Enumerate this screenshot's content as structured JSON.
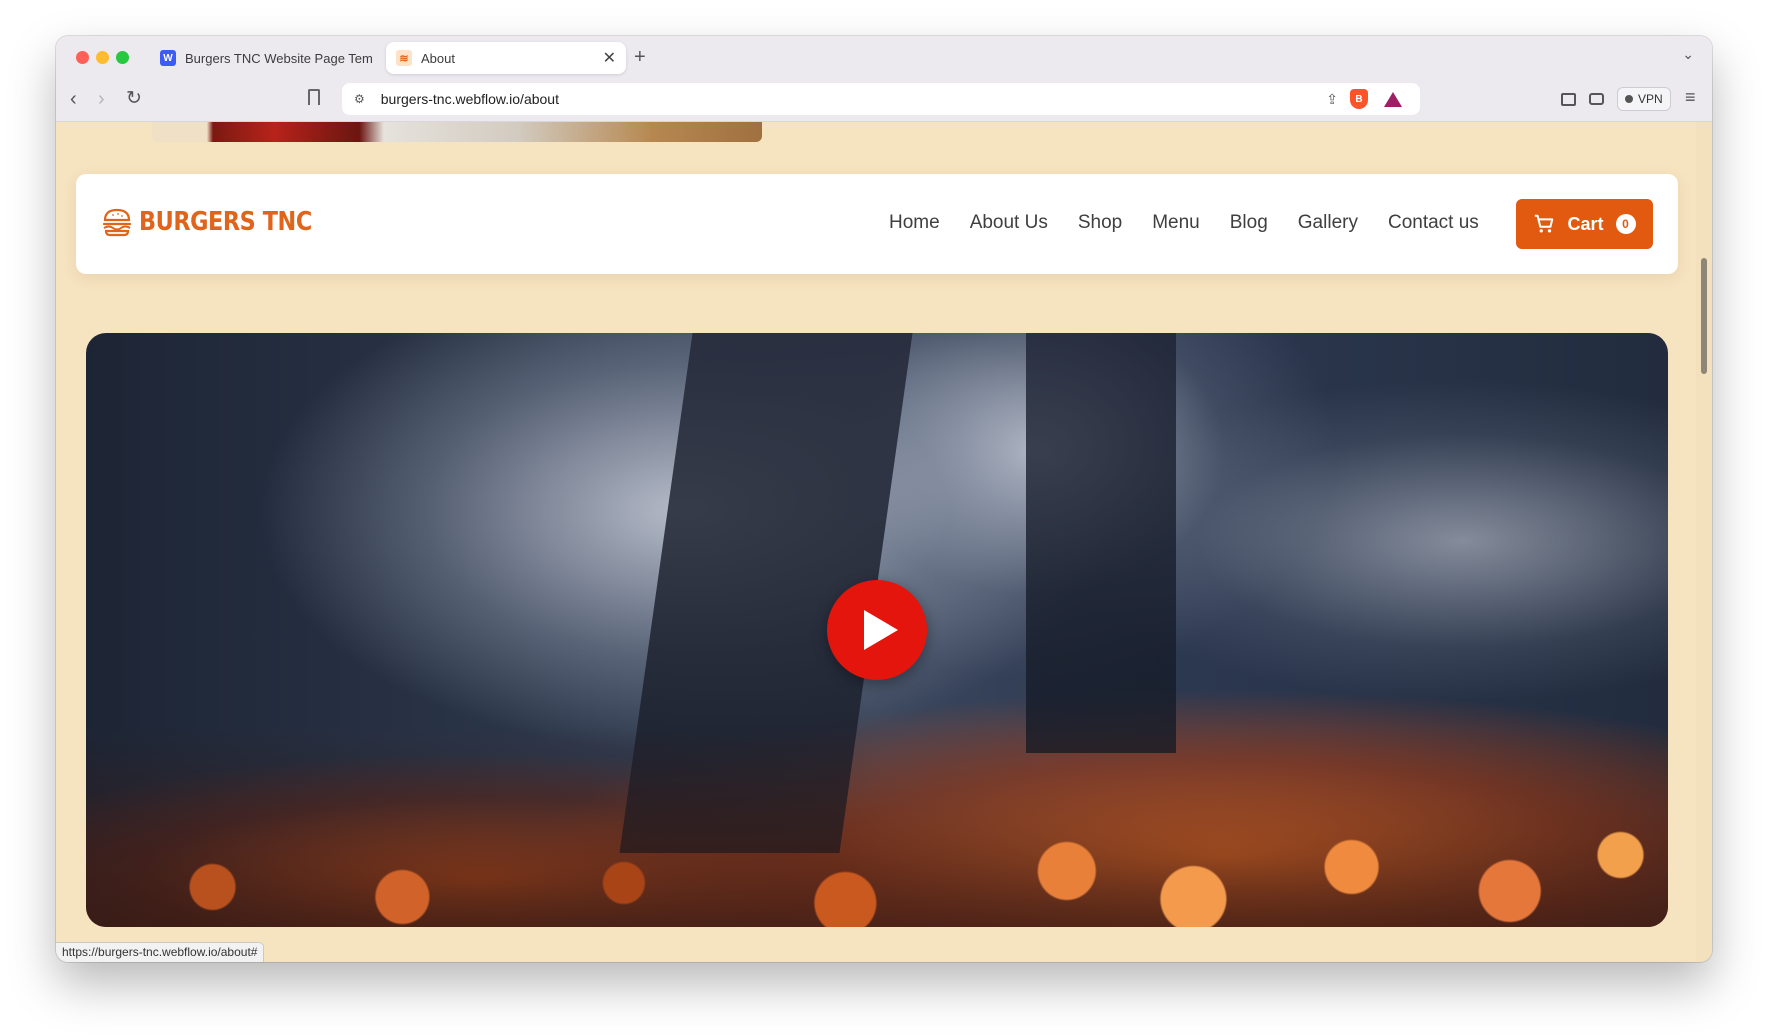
{
  "browser": {
    "tabs": [
      {
        "title": "Burgers TNC Website Page Templ",
        "active": false
      },
      {
        "title": "About",
        "active": true
      }
    ],
    "url": "burgers-tnc.webflow.io/about",
    "vpn_label": "VPN",
    "status_url": "https://burgers-tnc.webflow.io/about#"
  },
  "site": {
    "logo_text": "BURGERS TNC",
    "nav": [
      "Home",
      "About Us",
      "Shop",
      "Menu",
      "Blog",
      "Gallery",
      "Contact us"
    ],
    "cart": {
      "label": "Cart",
      "count": "0"
    }
  },
  "colors": {
    "page_background": "#f6e3bf",
    "brand_orange": "#e0641a",
    "cart_button": "#e25a0f",
    "play_button": "#e3150c"
  },
  "icons": [
    "search-icon",
    "burger-logo-icon",
    "cart-icon",
    "play-icon"
  ]
}
